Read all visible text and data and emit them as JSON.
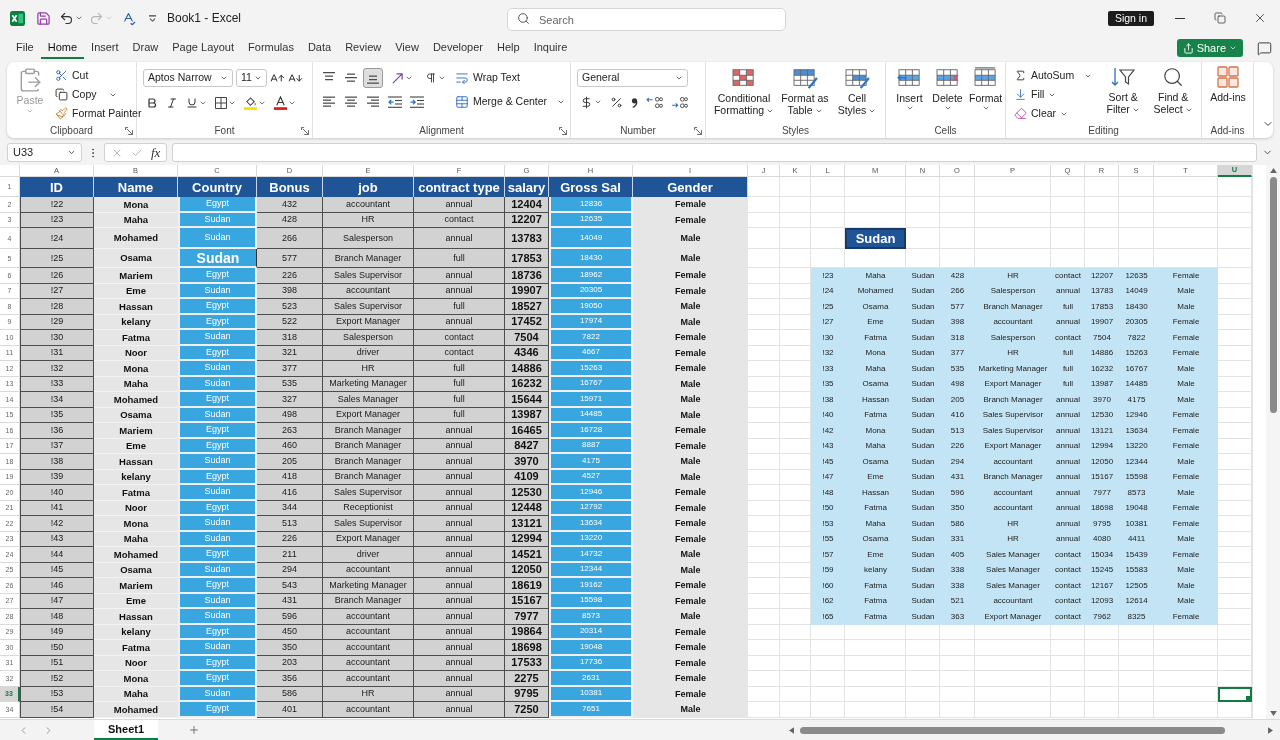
{
  "title_bar": {
    "document_title": "Book1 - Excel",
    "search": {
      "placeholder": "Search"
    },
    "sign_in": "Sign in"
  },
  "quick_access": {
    "undo": {
      "disabled": false
    },
    "redo": {
      "disabled": true
    }
  },
  "menu_tabs": [
    {
      "label": "File",
      "selected": false
    },
    {
      "label": "Home",
      "selected": true
    },
    {
      "label": "Insert",
      "selected": false
    },
    {
      "label": "Draw",
      "selected": false
    },
    {
      "label": "Page Layout",
      "selected": false
    },
    {
      "label": "Formulas",
      "selected": false
    },
    {
      "label": "Data",
      "selected": false
    },
    {
      "label": "Review",
      "selected": false
    },
    {
      "label": "View",
      "selected": false
    },
    {
      "label": "Developer",
      "selected": false
    },
    {
      "label": "Help",
      "selected": false
    },
    {
      "label": "Inquire",
      "selected": false
    }
  ],
  "share": "Share",
  "ribbon": {
    "clipboard": {
      "label": "Clipboard",
      "paste": {
        "label": "Paste",
        "disabled": true
      },
      "cut": "Cut",
      "copy": "Copy",
      "format_painter": "Format Painter"
    },
    "font": {
      "label": "Font",
      "font_name": "Aptos Narrow",
      "font_size": "11"
    },
    "alignment": {
      "label": "Alignment",
      "vertical_align": [
        {
          "kind": "top",
          "selected": false
        },
        {
          "kind": "middle",
          "selected": false
        },
        {
          "kind": "bottom",
          "selected": true
        }
      ],
      "wrap_text": "Wrap Text",
      "merge_center": "Merge & Center"
    },
    "number": {
      "label": "Number",
      "format": "General"
    },
    "styles": {
      "label": "Styles",
      "buttons": [
        {
          "kind": "conditional",
          "label": "Conditional Formatting"
        },
        {
          "kind": "table",
          "label": "Format as Table"
        },
        {
          "kind": "cell_styles",
          "label": "Cell Styles"
        }
      ]
    },
    "cells": {
      "label": "Cells",
      "buttons": [
        {
          "kind": "insert",
          "label": "Insert"
        },
        {
          "kind": "delete",
          "label": "Delete"
        },
        {
          "kind": "format",
          "label": "Format"
        }
      ]
    },
    "editing": {
      "label": "Editing",
      "autosum": "AutoSum",
      "fill": "Fill",
      "clear": "Clear",
      "sort_filter": "Sort & Filter",
      "find_select": "Find & Select"
    },
    "add_ins": {
      "label": "Add-ins",
      "button": "Add-ins"
    }
  },
  "formula_bar": {
    "name_box": "U33",
    "insert_function": "fx"
  },
  "sheet": {
    "columns": [
      {
        "label": "A",
        "selected": false
      },
      {
        "label": "B",
        "selected": false
      },
      {
        "label": "C",
        "selected": false
      },
      {
        "label": "D",
        "selected": false
      },
      {
        "label": "E",
        "selected": false
      },
      {
        "label": "F",
        "selected": false
      },
      {
        "label": "G",
        "selected": false
      },
      {
        "label": "H",
        "selected": false
      },
      {
        "label": "I",
        "selected": false
      },
      {
        "label": "J",
        "selected": false
      },
      {
        "label": "K",
        "selected": false
      },
      {
        "label": "L",
        "selected": false
      },
      {
        "label": "M",
        "selected": false
      },
      {
        "label": "N",
        "selected": false
      },
      {
        "label": "O",
        "selected": false
      },
      {
        "label": "P",
        "selected": false
      },
      {
        "label": "Q",
        "selected": false
      },
      {
        "label": "R",
        "selected": false
      },
      {
        "label": "S",
        "selected": false
      },
      {
        "label": "T",
        "selected": false
      },
      {
        "label": "U",
        "selected": true
      }
    ],
    "row_headers": [
      {
        "label": "1",
        "selected": false
      },
      {
        "label": "2",
        "selected": false
      },
      {
        "label": "3",
        "selected": false
      },
      {
        "label": "4",
        "selected": false
      },
      {
        "label": "5",
        "selected": false
      },
      {
        "label": "6",
        "selected": false
      },
      {
        "label": "7",
        "selected": false
      },
      {
        "label": "8",
        "selected": false
      },
      {
        "label": "9",
        "selected": false
      },
      {
        "label": "10",
        "selected": false
      },
      {
        "label": "11",
        "selected": false
      },
      {
        "label": "12",
        "selected": false
      },
      {
        "label": "13",
        "selected": false
      },
      {
        "label": "14",
        "selected": false
      },
      {
        "label": "15",
        "selected": false
      },
      {
        "label": "16",
        "selected": false
      },
      {
        "label": "17",
        "selected": false
      },
      {
        "label": "18",
        "selected": false
      },
      {
        "label": "19",
        "selected": false
      },
      {
        "label": "20",
        "selected": false
      },
      {
        "label": "21",
        "selected": false
      },
      {
        "label": "22",
        "selected": false
      },
      {
        "label": "23",
        "selected": false
      },
      {
        "label": "24",
        "selected": false
      },
      {
        "label": "25",
        "selected": false
      },
      {
        "label": "26",
        "selected": false
      },
      {
        "label": "27",
        "selected": false
      },
      {
        "label": "28",
        "selected": false
      },
      {
        "label": "29",
        "selected": false
      },
      {
        "label": "30",
        "selected": false
      },
      {
        "label": "31",
        "selected": false
      },
      {
        "label": "32",
        "selected": false
      },
      {
        "label": "33",
        "selected": true
      },
      {
        "label": "34",
        "selected": false
      }
    ]
  },
  "employee_table": {
    "columns": [
      "ID",
      "Name",
      "Country",
      "Bonus",
      "job",
      "contract type",
      "salary",
      "Gross Sal",
      "Gender"
    ],
    "rows": [
      {
        "cells": [
          "!22",
          "Mona",
          "Egypt",
          "432",
          "accountant",
          "annual",
          "12404",
          "12836",
          "Female"
        ],
        "country_enlarged": false
      },
      {
        "cells": [
          "!23",
          "Maha",
          "Sudan",
          "428",
          "HR",
          "contact",
          "12207",
          "12635",
          "Female"
        ],
        "country_enlarged": false
      },
      {
        "cells": [
          "!24",
          "Mohamed",
          "Sudan",
          "266",
          "Salesperson",
          "annual",
          "13783",
          "14049",
          "Male"
        ],
        "country_enlarged": false
      },
      {
        "cells": [
          "!25",
          "Osama",
          "Sudan",
          "577",
          "Branch Manager",
          "full",
          "17853",
          "18430",
          "Male"
        ],
        "country_enlarged": true
      },
      {
        "cells": [
          "!26",
          "Mariem",
          "Egypt",
          "226",
          "Sales Supervisor",
          "annual",
          "18736",
          "18962",
          "Female"
        ],
        "country_enlarged": false
      },
      {
        "cells": [
          "!27",
          "Eme",
          "Sudan",
          "398",
          "accountant",
          "annual",
          "19907",
          "20305",
          "Female"
        ],
        "country_enlarged": false
      },
      {
        "cells": [
          "!28",
          "Hassan",
          "Egypt",
          "523",
          "Sales Supervisor",
          "full",
          "18527",
          "19050",
          "Male"
        ],
        "country_enlarged": false
      },
      {
        "cells": [
          "!29",
          "kelany",
          "Egypt",
          "522",
          "Export Manager",
          "annual",
          "17452",
          "17974",
          "Male"
        ],
        "country_enlarged": false
      },
      {
        "cells": [
          "!30",
          "Fatma",
          "Sudan",
          "318",
          "Salesperson",
          "contact",
          "7504",
          "7822",
          "Female"
        ],
        "country_enlarged": false
      },
      {
        "cells": [
          "!31",
          "Noor",
          "Egypt",
          "321",
          "driver",
          "contact",
          "4346",
          "4667",
          "Female"
        ],
        "country_enlarged": false
      },
      {
        "cells": [
          "!32",
          "Mona",
          "Sudan",
          "377",
          "HR",
          "full",
          "14886",
          "15263",
          "Female"
        ],
        "country_enlarged": false
      },
      {
        "cells": [
          "!33",
          "Maha",
          "Sudan",
          "535",
          "Marketing Manager",
          "full",
          "16232",
          "16767",
          "Male"
        ],
        "country_enlarged": false
      },
      {
        "cells": [
          "!34",
          "Mohamed",
          "Egypt",
          "327",
          "Sales Manager",
          "full",
          "15644",
          "15971",
          "Male"
        ],
        "country_enlarged": false
      },
      {
        "cells": [
          "!35",
          "Osama",
          "Sudan",
          "498",
          "Export Manager",
          "full",
          "13987",
          "14485",
          "Male"
        ],
        "country_enlarged": false
      },
      {
        "cells": [
          "!36",
          "Mariem",
          "Egypt",
          "263",
          "Branch Manager",
          "annual",
          "16465",
          "16728",
          "Female"
        ],
        "country_enlarged": false
      },
      {
        "cells": [
          "!37",
          "Eme",
          "Egypt",
          "460",
          "Branch Manager",
          "annual",
          "8427",
          "8887",
          "Female"
        ],
        "country_enlarged": false
      },
      {
        "cells": [
          "!38",
          "Hassan",
          "Sudan",
          "205",
          "Branch Manager",
          "annual",
          "3970",
          "4175",
          "Male"
        ],
        "country_enlarged": false
      },
      {
        "cells": [
          "!39",
          "kelany",
          "Egypt",
          "418",
          "Branch Manager",
          "annual",
          "4109",
          "4527",
          "Male"
        ],
        "country_enlarged": false
      },
      {
        "cells": [
          "!40",
          "Fatma",
          "Sudan",
          "416",
          "Sales Supervisor",
          "annual",
          "12530",
          "12946",
          "Female"
        ],
        "country_enlarged": false
      },
      {
        "cells": [
          "!41",
          "Noor",
          "Egypt",
          "344",
          "Receptionist",
          "annual",
          "12448",
          "12792",
          "Female"
        ],
        "country_enlarged": false
      },
      {
        "cells": [
          "!42",
          "Mona",
          "Sudan",
          "513",
          "Sales Supervisor",
          "annual",
          "13121",
          "13634",
          "Female"
        ],
        "country_enlarged": false
      },
      {
        "cells": [
          "!43",
          "Maha",
          "Sudan",
          "226",
          "Export Manager",
          "annual",
          "12994",
          "13220",
          "Female"
        ],
        "country_enlarged": false
      },
      {
        "cells": [
          "!44",
          "Mohamed",
          "Egypt",
          "211",
          "driver",
          "annual",
          "14521",
          "14732",
          "Male"
        ],
        "country_enlarged": false
      },
      {
        "cells": [
          "!45",
          "Osama",
          "Sudan",
          "294",
          "accountant",
          "annual",
          "12050",
          "12344",
          "Male"
        ],
        "country_enlarged": false
      },
      {
        "cells": [
          "!46",
          "Mariem",
          "Egypt",
          "543",
          "Marketing Manager",
          "annual",
          "18619",
          "19162",
          "Female"
        ],
        "country_enlarged": false
      },
      {
        "cells": [
          "!47",
          "Eme",
          "Sudan",
          "431",
          "Branch Manager",
          "annual",
          "15167",
          "15598",
          "Female"
        ],
        "country_enlarged": false
      },
      {
        "cells": [
          "!48",
          "Hassan",
          "Sudan",
          "596",
          "accountant",
          "annual",
          "7977",
          "8573",
          "Male"
        ],
        "country_enlarged": false
      },
      {
        "cells": [
          "!49",
          "kelany",
          "Egypt",
          "450",
          "accountant",
          "annual",
          "19864",
          "20314",
          "Female"
        ],
        "country_enlarged": false
      },
      {
        "cells": [
          "!50",
          "Fatma",
          "Sudan",
          "350",
          "accountant",
          "annual",
          "18698",
          "19048",
          "Female"
        ],
        "country_enlarged": false
      },
      {
        "cells": [
          "!51",
          "Noor",
          "Egypt",
          "203",
          "accountant",
          "annual",
          "17533",
          "17736",
          "Female"
        ],
        "country_enlarged": false
      },
      {
        "cells": [
          "!52",
          "Mona",
          "Egypt",
          "356",
          "accountant",
          "annual",
          "2275",
          "2631",
          "Female"
        ],
        "country_enlarged": false
      },
      {
        "cells": [
          "!53",
          "Maha",
          "Sudan",
          "586",
          "HR",
          "annual",
          "9795",
          "10381",
          "Female"
        ],
        "country_enlarged": false
      },
      {
        "cells": [
          "!54",
          "Mohamed",
          "Egypt",
          "401",
          "accountant",
          "annual",
          "7250",
          "7651",
          "Male"
        ],
        "country_enlarged": false
      }
    ]
  },
  "filter_label": "Sudan",
  "filtered_table": {
    "rows": [
      [
        "!23",
        "Maha",
        "Sudan",
        "428",
        "HR",
        "contact",
        "12207",
        "12635",
        "Female"
      ],
      [
        "!24",
        "Mohamed",
        "Sudan",
        "266",
        "Salesperson",
        "annual",
        "13783",
        "14049",
        "Male"
      ],
      [
        "!25",
        "Osama",
        "Sudan",
        "577",
        "Branch Manager",
        "full",
        "17853",
        "18430",
        "Male"
      ],
      [
        "!27",
        "Eme",
        "Sudan",
        "398",
        "accountant",
        "annual",
        "19907",
        "20305",
        "Female"
      ],
      [
        "!30",
        "Fatma",
        "Sudan",
        "318",
        "Salesperson",
        "contact",
        "7504",
        "7822",
        "Female"
      ],
      [
        "!32",
        "Mona",
        "Sudan",
        "377",
        "HR",
        "full",
        "14886",
        "15263",
        "Female"
      ],
      [
        "!33",
        "Maha",
        "Sudan",
        "535",
        "Marketing Manager",
        "full",
        "16232",
        "16767",
        "Male"
      ],
      [
        "!35",
        "Osama",
        "Sudan",
        "498",
        "Export Manager",
        "full",
        "13987",
        "14485",
        "Male"
      ],
      [
        "!38",
        "Hassan",
        "Sudan",
        "205",
        "Branch Manager",
        "annual",
        "3970",
        "4175",
        "Male"
      ],
      [
        "!40",
        "Fatma",
        "Sudan",
        "416",
        "Sales Supervisor",
        "annual",
        "12530",
        "12946",
        "Female"
      ],
      [
        "!42",
        "Mona",
        "Sudan",
        "513",
        "Sales Supervisor",
        "annual",
        "13121",
        "13634",
        "Female"
      ],
      [
        "!43",
        "Maha",
        "Sudan",
        "226",
        "Export Manager",
        "annual",
        "12994",
        "13220",
        "Female"
      ],
      [
        "!45",
        "Osama",
        "Sudan",
        "294",
        "accountant",
        "annual",
        "12050",
        "12344",
        "Male"
      ],
      [
        "!47",
        "Eme",
        "Sudan",
        "431",
        "Branch Manager",
        "annual",
        "15167",
        "15598",
        "Female"
      ],
      [
        "!48",
        "Hassan",
        "Sudan",
        "596",
        "accountant",
        "annual",
        "7977",
        "8573",
        "Male"
      ],
      [
        "!50",
        "Fatma",
        "Sudan",
        "350",
        "accountant",
        "annual",
        "18698",
        "19048",
        "Female"
      ],
      [
        "!53",
        "Maha",
        "Sudan",
        "586",
        "HR",
        "annual",
        "9795",
        "10381",
        "Female"
      ],
      [
        "!55",
        "Osama",
        "Sudan",
        "331",
        "HR",
        "annual",
        "4080",
        "4411",
        "Male"
      ],
      [
        "!57",
        "Eme",
        "Sudan",
        "405",
        "Sales Manager",
        "contact",
        "15034",
        "15439",
        "Female"
      ],
      [
        "!59",
        "kelany",
        "Sudan",
        "338",
        "Sales Manager",
        "contact",
        "15245",
        "15583",
        "Male"
      ],
      [
        "!60",
        "Fatma",
        "Sudan",
        "338",
        "Sales Manager",
        "contact",
        "12167",
        "12505",
        "Male"
      ],
      [
        "!62",
        "Fatma",
        "Sudan",
        "521",
        "accountant",
        "contact",
        "12093",
        "12614",
        "Male"
      ],
      [
        "!65",
        "Fatma",
        "Sudan",
        "363",
        "Export Manager",
        "contact",
        "7962",
        "8325",
        "Female"
      ]
    ]
  },
  "sheet_tabs": [
    {
      "label": "Sheet1",
      "selected": true
    }
  ]
}
